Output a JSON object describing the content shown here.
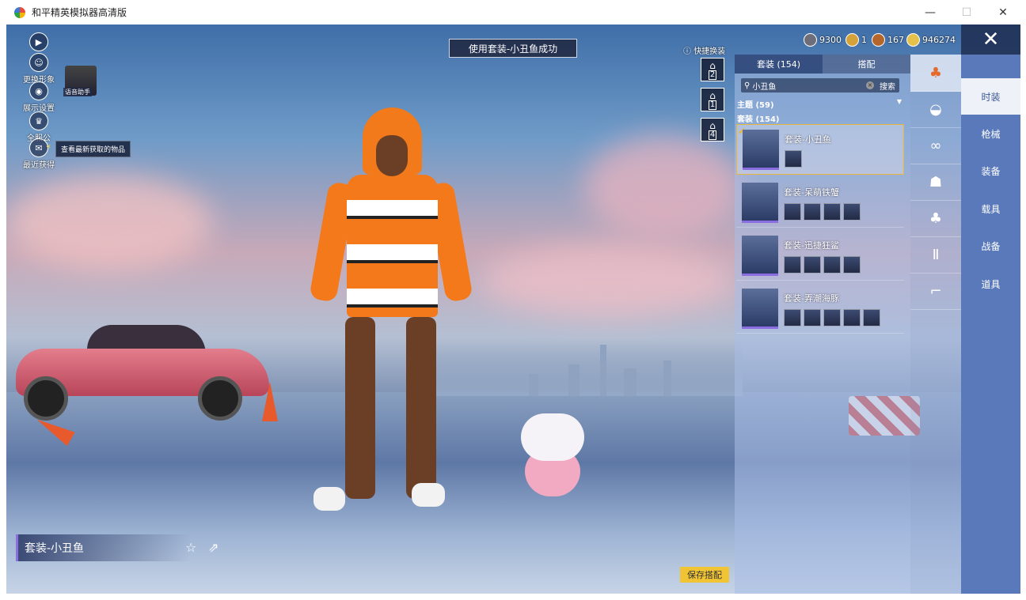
{
  "window": {
    "title": "和平精英模拟器高清版",
    "min": "—",
    "max": "☐",
    "close": "✕"
  },
  "left_buttons": [
    {
      "icon": "▶",
      "label": ""
    },
    {
      "icon": "☺",
      "label": "更换形象"
    },
    {
      "icon": "◉",
      "label": "展示设置"
    },
    {
      "icon": "♛",
      "label": "全服公"
    },
    {
      "icon": "✉",
      "label": "最近获得"
    }
  ],
  "avatar_label": "语音助手",
  "tooltip": "查看最新获取的物品",
  "toast": "使用套装-小丑鱼成功",
  "currencies": [
    {
      "value": "9300",
      "color": "#6e6e7a"
    },
    {
      "value": "1",
      "color": "#d5a23a"
    },
    {
      "value": "167",
      "color": "#b5662b"
    },
    {
      "value": "946274",
      "color": "#e4c14a"
    }
  ],
  "close_icon": "✕",
  "quick": {
    "label": "快捷换装",
    "slots": [
      "2",
      "1",
      "4"
    ]
  },
  "panel": {
    "tabs": [
      "套装 (154)",
      "搭配"
    ],
    "search_value": "小丑鱼",
    "search_button": "搜索",
    "theme": "主题 (59)",
    "count": "套装 (154)",
    "items": [
      {
        "name": "套装-小丑鱼",
        "parts": 1
      },
      {
        "name": "套装-呆萌铁蟹",
        "parts": 4
      },
      {
        "name": "套装-迅捷狂鲨",
        "parts": 4
      },
      {
        "name": "套装-弄潮海豚",
        "parts": 5
      }
    ]
  },
  "menu": [
    "时装",
    "枪械",
    "装备",
    "载具",
    "战备",
    "道具"
  ],
  "outfit_name": "套装-小丑鱼",
  "save_button": "保存搭配"
}
